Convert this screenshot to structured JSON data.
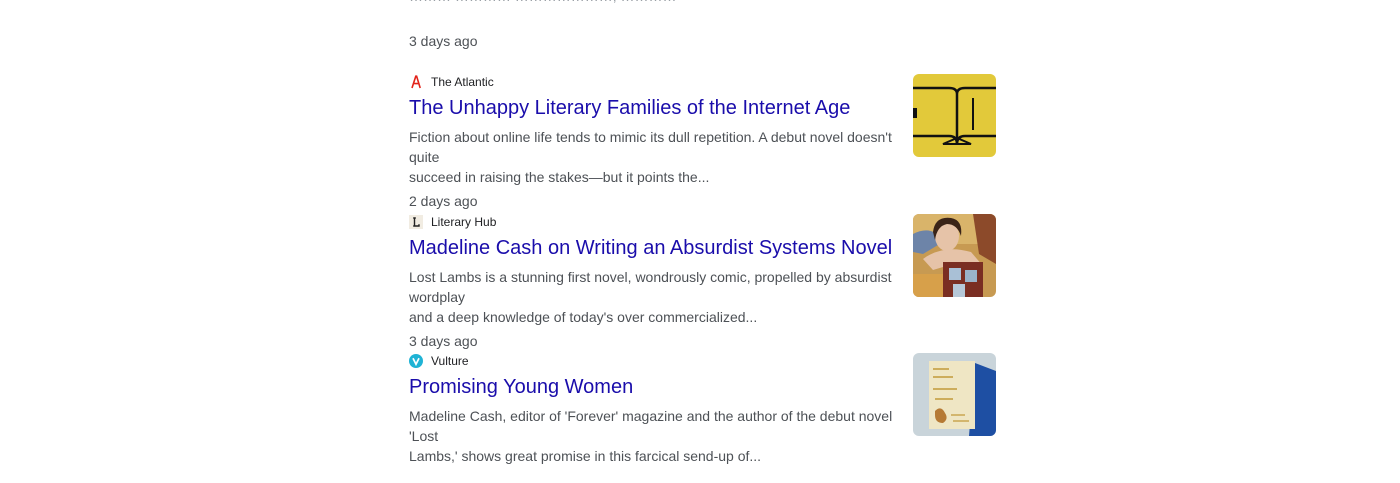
{
  "top_result": {
    "time": "3 days ago"
  },
  "results": [
    {
      "source": "The Atlantic",
      "favicon": "atlantic-logo-icon",
      "title": "The Unhappy Literary Families of the Internet Age",
      "snippet_line1": "Fiction about online life tends to mimic its dull repetition. A debut novel doesn't quite",
      "snippet_line2": "succeed in raising the stakes—but it points the...",
      "time": "2 days ago"
    },
    {
      "source": "Literary Hub",
      "favicon": "literary-hub-logo-icon",
      "title": "Madeline Cash on Writing an Absurdist Systems Novel",
      "snippet_line1": "Lost Lambs is a stunning first novel, wondrously comic, propelled by absurdist wordplay",
      "snippet_line2": "and a deep knowledge of today's over commercialized...",
      "time": "3 days ago"
    },
    {
      "source": "Vulture",
      "favicon": "vulture-logo-icon",
      "title": "Promising Young Women",
      "snippet_line1": "Madeline Cash, editor of 'Forever' magazine and the author of the debut novel 'Lost",
      "snippet_line2": "Lambs,' shows great promise in this farcical send-up of...",
      "time": ""
    }
  ],
  "colors": {
    "title_link": "#1a0dab",
    "snippet": "#4d5156",
    "atlantic_red": "#e2231a",
    "vulture_teal": "#1fb3d5",
    "thumb_yellow": "#e2c93a"
  }
}
